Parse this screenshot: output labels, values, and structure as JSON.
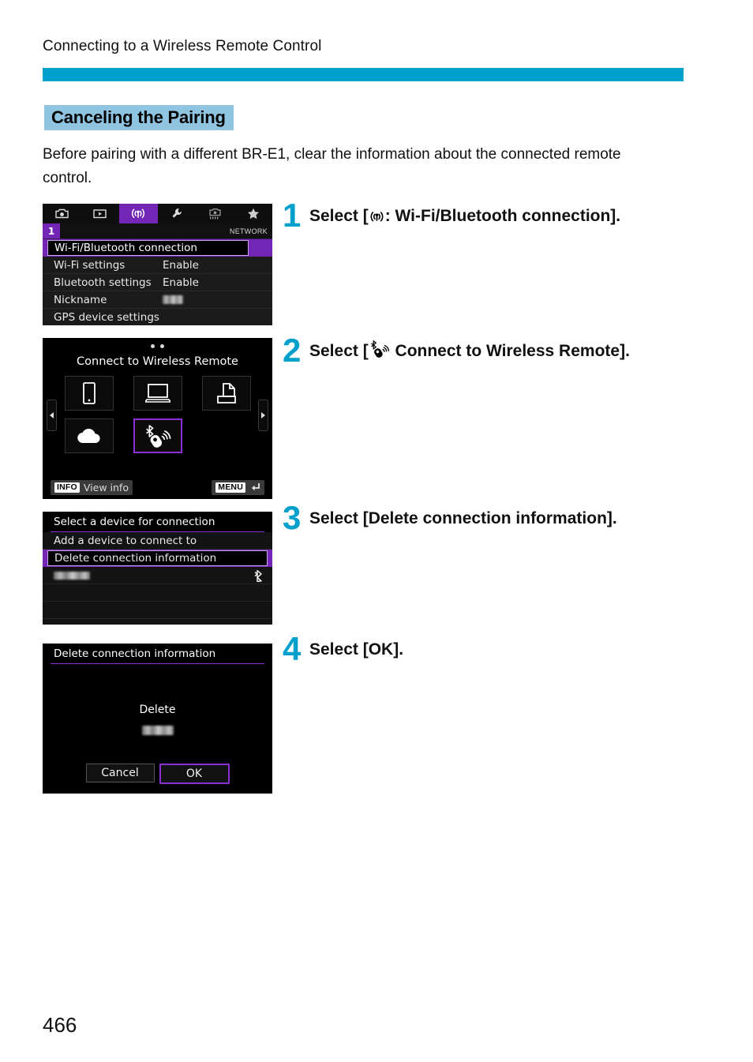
{
  "header": {
    "chapter_title": "Connecting to a Wireless Remote Control",
    "rule_color": "#00a0cc"
  },
  "section": {
    "heading": "Canceling the Pairing",
    "heading_bg": "#8fc5e0",
    "intro": "Before pairing with a different BR-E1, clear the information about the connected remote control."
  },
  "steps": [
    {
      "number": "1",
      "text": "Select [: Wi-Fi/Bluetooth connection].",
      "icon": "wifi-icon"
    },
    {
      "number": "2",
      "text": "Select [ Connect to Wireless Remote].",
      "icon": "wireless-remote-icon"
    },
    {
      "number": "3",
      "text": "Select [Delete connection information].",
      "icon": ""
    },
    {
      "number": "4",
      "text": "Select [OK].",
      "icon": ""
    }
  ],
  "step_text_parts": {
    "s1_a": "Select [",
    "s1_b": ": Wi-Fi/Bluetooth connection].",
    "s2_a": "Select [",
    "s2_b": " Connect to Wireless Remote].",
    "s3": "Select [Delete connection information].",
    "s4": "Select [OK]."
  },
  "screenshot1": {
    "tabs": [
      {
        "name": "shooting-tab",
        "icon": "camera-icon",
        "active": false
      },
      {
        "name": "playback-tab",
        "icon": "playback-icon",
        "active": false
      },
      {
        "name": "network-tab",
        "icon": "wifi-icon",
        "active": true
      },
      {
        "name": "setup-tab",
        "icon": "wrench-icon",
        "active": false
      },
      {
        "name": "custom-functions-tab",
        "icon": "custom-icon",
        "active": false
      },
      {
        "name": "my-menu-tab",
        "icon": "star-icon",
        "active": false
      }
    ],
    "page_number": "1",
    "group_label": "NETWORK",
    "rows": [
      {
        "label": "Wi-Fi/Bluetooth connection",
        "value": "",
        "selected": true
      },
      {
        "label": "Wi-Fi settings",
        "value": "Enable",
        "selected": false
      },
      {
        "label": "Bluetooth settings",
        "value": "Enable",
        "selected": false
      },
      {
        "label": "Nickname",
        "value": "",
        "value_blurred": true,
        "selected": false
      },
      {
        "label": "GPS device settings",
        "value": "",
        "selected": false
      }
    ],
    "highlight_color": "#7326b5"
  },
  "screenshot2": {
    "title": "Connect to Wireless Remote",
    "page_dots": 2,
    "tiles": [
      {
        "name": "smartphone-tile",
        "icon": "smartphone-icon",
        "selected": false
      },
      {
        "name": "computer-tile",
        "icon": "laptop-icon",
        "selected": false
      },
      {
        "name": "printer-tile",
        "icon": "printer-icon",
        "selected": false
      },
      {
        "name": "web-service-tile",
        "icon": "cloud-icon",
        "selected": false
      },
      {
        "name": "wireless-remote-tile",
        "icon": "bluetooth-remote-icon",
        "selected": true
      }
    ],
    "info_key": "INFO",
    "info_label": "View info",
    "menu_key": "MENU",
    "selection_color": "#8b30d0"
  },
  "screenshot3": {
    "title": "Select a device for connection",
    "rows": [
      {
        "label": "Add a device to connect to",
        "selected": false,
        "bluetooth": false
      },
      {
        "label": "Delete connection information",
        "selected": true,
        "bluetooth": false
      },
      {
        "label": "",
        "blurred": true,
        "selected": false,
        "bluetooth": true
      },
      {
        "label": "",
        "selected": false,
        "bluetooth": false
      },
      {
        "label": "",
        "selected": false,
        "bluetooth": false
      }
    ]
  },
  "screenshot4": {
    "title": "Delete connection information",
    "message": "Delete",
    "device_name_blurred": true,
    "buttons": [
      {
        "label": "Cancel",
        "selected": false
      },
      {
        "label": "OK",
        "selected": true
      }
    ]
  },
  "footer": {
    "page_number": "466"
  }
}
